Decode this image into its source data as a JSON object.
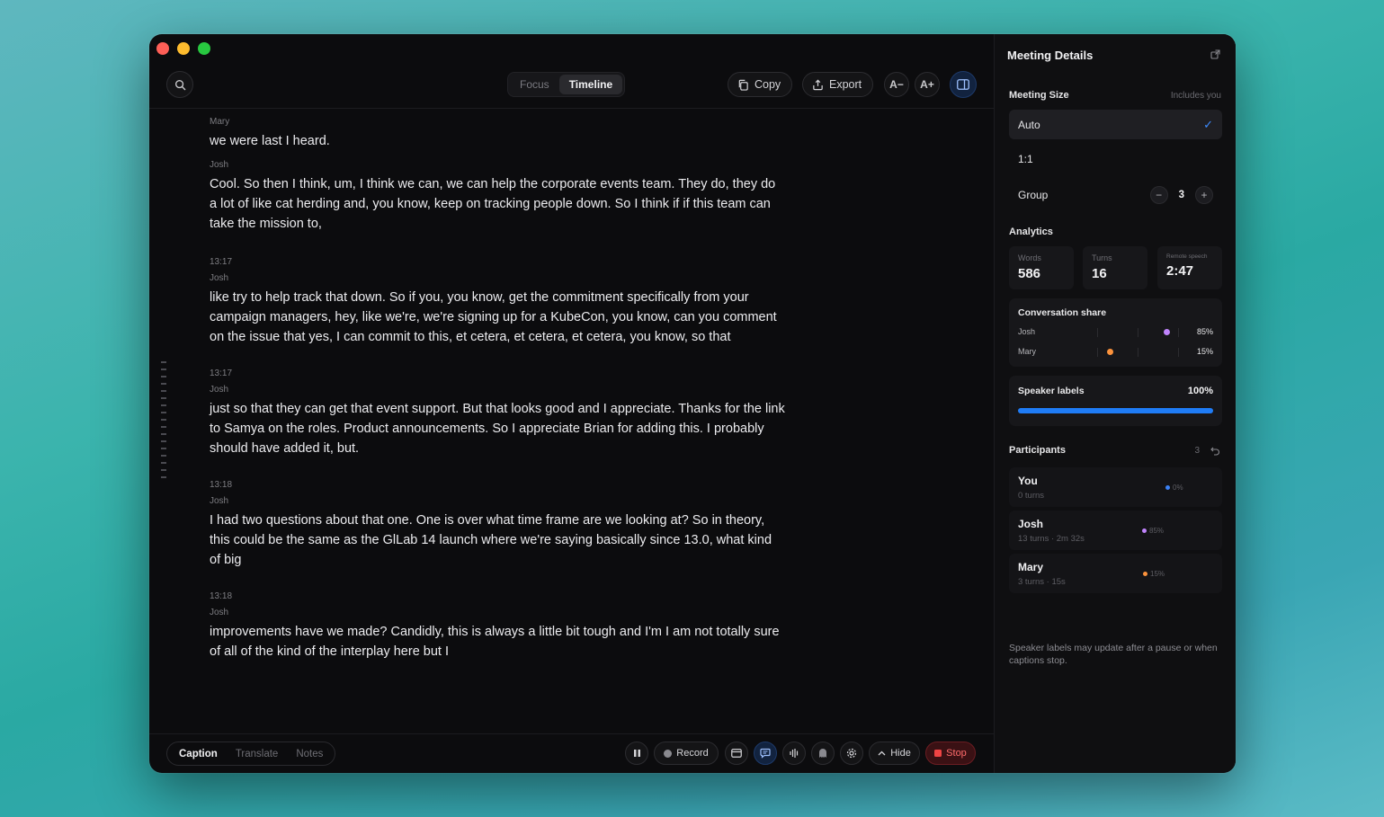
{
  "toolbar": {
    "view_tabs": [
      {
        "label": "Focus",
        "active": false
      },
      {
        "label": "Timeline",
        "active": true
      }
    ],
    "copy_label": "Copy",
    "export_label": "Export",
    "font_decrease_label": "A−",
    "font_increase_label": "A+"
  },
  "transcript": [
    {
      "time": "",
      "speaker": "Mary",
      "text": "we were last I heard."
    },
    {
      "time": "",
      "speaker": "Josh",
      "text": "Cool. So then I think, um, I think we can, we can help the corporate events team. They do, they do a lot of like cat herding and, you know, keep on tracking people down. So I think if if this team can take the mission to,"
    },
    {
      "time": "13:17",
      "speaker": "Josh",
      "text": "like try to help track that down. So if you, you know, get the commitment specifically from your campaign managers, hey, like we're, we're signing up for a KubeCon, you know, can you comment on the issue that yes, I can commit to this, et cetera, et cetera, et cetera, you know, so that"
    },
    {
      "time": "13:17",
      "speaker": "Josh",
      "text": "just so that they can get that event support. But that looks good and I appreciate. Thanks for the link to Samya on the roles. Product announcements. So I appreciate Brian for adding this. I probably should have added it, but."
    },
    {
      "time": "13:18",
      "speaker": "Josh",
      "text": "I had two questions about that one. One is over what time frame are we looking at? So in theory, this could be the same as the GlLab 14 launch where we're saying basically since 13.0, what kind of big"
    },
    {
      "time": "13:18",
      "speaker": "Josh",
      "text": "improvements have we made? Candidly, this is always a little bit tough and I'm I am not totally sure of all of the kind of the interplay here but I"
    }
  ],
  "bottombar": {
    "modes": [
      {
        "label": "Caption",
        "active": true
      },
      {
        "label": "Translate",
        "active": false
      },
      {
        "label": "Notes",
        "active": false
      }
    ],
    "record_label": "Record",
    "hide_label": "Hide",
    "stop_label": "Stop"
  },
  "sidebar": {
    "title": "Meeting Details",
    "meeting_size": {
      "label": "Meeting Size",
      "hint": "Includes you",
      "options": [
        "Auto",
        "1:1",
        "Group"
      ],
      "selected": "Auto",
      "group_count": "3"
    },
    "analytics": {
      "label": "Analytics",
      "stats": [
        {
          "label": "Words",
          "value": "586"
        },
        {
          "label": "Turns",
          "value": "16"
        },
        {
          "label": "Remote speech",
          "value": "2:47"
        }
      ],
      "conversation_share": {
        "title": "Conversation share",
        "rows": [
          {
            "name": "Josh",
            "percent": "85%",
            "value": 85,
            "color": "#c084fc"
          },
          {
            "name": "Mary",
            "percent": "15%",
            "value": 15,
            "color": "#fb923c"
          }
        ]
      },
      "speaker_labels": {
        "title": "Speaker labels",
        "percent": "100%",
        "value": 100
      }
    },
    "participants": {
      "label": "Participants",
      "count": "3",
      "items": [
        {
          "name": "You",
          "sub": "0 turns",
          "share": "0%",
          "color": "#3b82f6"
        },
        {
          "name": "Josh",
          "sub": "13 turns · 2m 32s",
          "share": "85%",
          "color": "#c084fc"
        },
        {
          "name": "Mary",
          "sub": "3 turns · 15s",
          "share": "15%",
          "color": "#fb923c"
        }
      ]
    },
    "footnote": "Speaker labels may update after a pause or when captions stop."
  },
  "colors": {
    "accent": "#1f7cf6",
    "stop": "#ef4444"
  }
}
